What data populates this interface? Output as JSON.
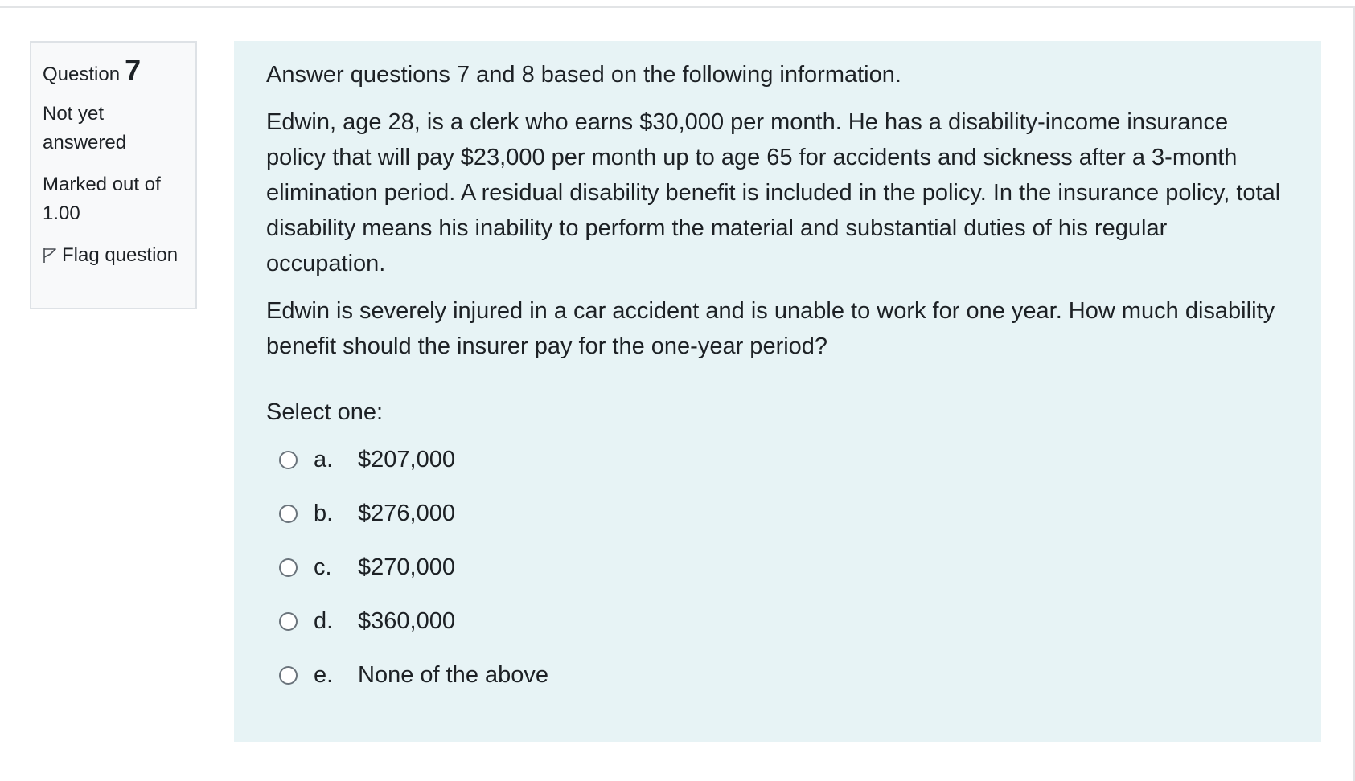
{
  "info": {
    "question_label": "Question",
    "question_number": "7",
    "state": "Not yet answered",
    "grade": "Marked out of 1.00",
    "flag_label": "Flag question"
  },
  "question": {
    "intro": "Answer questions 7 and 8 based on the following information.",
    "scenario": "Edwin, age 28, is a clerk who earns $30,000 per month. He has a disability-income insurance policy that will pay $23,000 per month up to age 65 for accidents and sickness after a 3-month elimination period. A residual disability benefit is included in the policy. In the insurance policy, total disability means his inability to perform the material and substantial duties of his regular occupation.",
    "question_text": "Edwin is severely injured in a car accident and is unable to work for one year. How much disability benefit should the insurer pay for the one-year period?",
    "prompt": "Select one:",
    "options": [
      {
        "letter": "a.",
        "text": "$207,000",
        "selected": false
      },
      {
        "letter": "b.",
        "text": "$276,000",
        "selected": false
      },
      {
        "letter": "c.",
        "text": "$270,000",
        "selected": false
      },
      {
        "letter": "d.",
        "text": "$360,000",
        "selected": false
      },
      {
        "letter": "e.",
        "text": "None of the above",
        "selected": false
      }
    ]
  },
  "colors": {
    "panel_background": "#e7f3f5",
    "info_background": "#f8f9fa",
    "text": "#1d2125"
  }
}
